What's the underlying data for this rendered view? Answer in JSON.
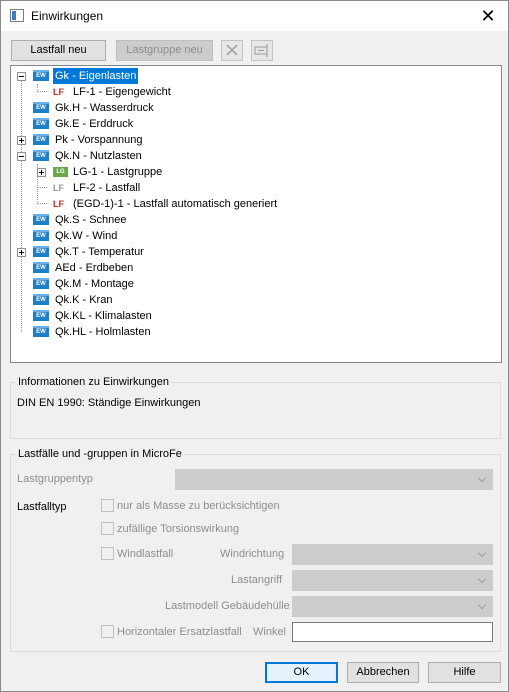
{
  "window": {
    "title": "Einwirkungen",
    "close_icon": "close-icon"
  },
  "toolbar": {
    "new_loadcase": "Lastfall neu",
    "new_loadgroup": "Lastgruppe neu"
  },
  "tree": {
    "items": [
      {
        "label": "Gk - Eigenlasten"
      },
      {
        "label": "LF-1 - Eigengewicht"
      },
      {
        "label": "Gk.H - Wasserdruck"
      },
      {
        "label": "Gk.E - Erddruck"
      },
      {
        "label": "Pk - Vorspannung"
      },
      {
        "label": "Qk.N - Nutzlasten"
      },
      {
        "label": "LG-1 - Lastgruppe"
      },
      {
        "label": "LF-2 - Lastfall"
      },
      {
        "label": "(EGD-1)-1 - Lastfall automatisch generiert"
      },
      {
        "label": "Qk.S - Schnee"
      },
      {
        "label": "Qk.W - Wind"
      },
      {
        "label": "Qk.T - Temperatur"
      },
      {
        "label": "AEd - Erdbeben"
      },
      {
        "label": "Qk.M - Montage"
      },
      {
        "label": "Qk.K - Kran"
      },
      {
        "label": "Qk.KL - Klimalasten"
      },
      {
        "label": "Qk.HL - Holmlasten"
      }
    ],
    "icon_ew": "EW",
    "icon_lf": "LF",
    "icon_lg": "LG"
  },
  "info": {
    "title": "Informationen zu Einwirkungen",
    "text": "DIN EN 1990: Ständige Einwirkungen"
  },
  "microfe": {
    "title": "Lastfälle und -gruppen in MicroFe",
    "loadgroup_type_label": "Lastgruppentyp",
    "loadcase_type_label": "Lastfalltyp",
    "mass_only": "nur als Masse zu berücksichtigen",
    "torsion": "zufällige Torsionswirkung",
    "wind_loadcase": "Windlastfall",
    "wind_direction": "Windrichtung",
    "load_attack": "Lastangriff",
    "load_model": "Lastmodell Gebäudehülle",
    "horizontal_substitute": "Horizontaler Ersatzlastfall",
    "angle": "Winkel"
  },
  "buttons": {
    "ok": "OK",
    "cancel": "Abbrechen",
    "help": "Hilfe"
  },
  "colors": {
    "selection": "#0078d7",
    "ew_icon": "#1f7fc6",
    "lg_icon": "#6aa84f",
    "lf_red": "#c22222"
  }
}
